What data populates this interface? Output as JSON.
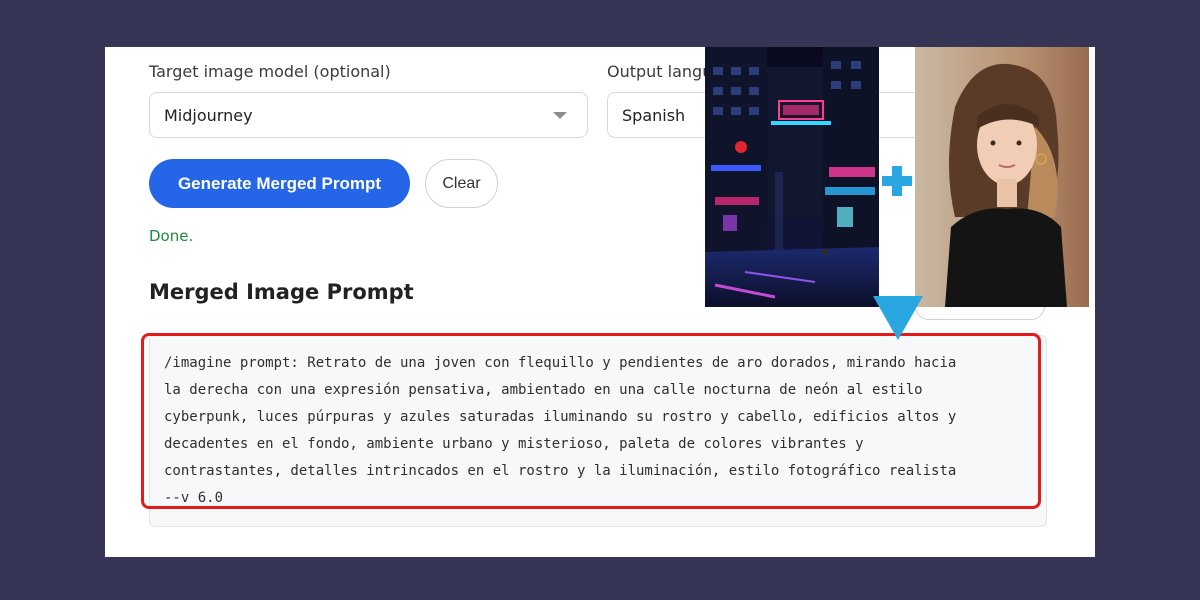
{
  "form": {
    "target_model_label": "Target image model (optional)",
    "target_model_value": "Midjourney",
    "output_language_label": "Output langu",
    "output_language_value": "Spanish"
  },
  "actions": {
    "generate_label": "Generate Merged Prompt",
    "clear_label": "Clear"
  },
  "status": {
    "text": "Done."
  },
  "result": {
    "heading": "Merged Image Prompt",
    "prompt": "/imagine prompt: Retrato de una joven con flequillo y pendientes de aro dorados, mirando hacia\nla derecha con una expresión pensativa, ambientado en una calle nocturna de neón al estilo\ncyberpunk, luces púrpuras y azules saturadas iluminando su rostro y cabello, edificios altos y\ndecadentes en el fondo, ambiente urbano y misterioso, paleta de colores vibrantes y\ncontrastantes, detalles intrincados en el rostro y la iluminación, estilo fotográfico realista\n--v 6.0"
  },
  "overlay": {
    "left_image": "neon-cyberpunk-street-photo",
    "right_image": "portrait-young-woman-photo",
    "plus_icon": "plus-icon",
    "arrow_icon": "down-arrow-icon"
  },
  "colors": {
    "background": "#363556",
    "primary": "#2566e8",
    "highlight": "#e31b1b",
    "success": "#1e8b3a",
    "accent": "#2aa6e0"
  }
}
